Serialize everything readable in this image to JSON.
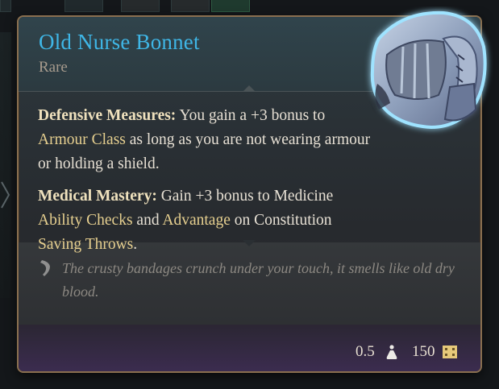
{
  "item": {
    "name": "Old Nurse Bonnet",
    "rarity": "Rare",
    "colors": {
      "name": "#3fb6e6",
      "rarity": "#a89c8e",
      "highlight": "#e6cf8f",
      "frame": "#8a6f4f"
    },
    "passives": [
      {
        "title": "Defensive Measures:",
        "text1": " You gain a +3 bonus to ",
        "link1": "Armour Class",
        "text2": " as long as you are not wearing armour or holding a shield."
      },
      {
        "title": "Medical Mastery:",
        "text1": " Gain +3 bonus to Medicine ",
        "link1": "Ability Checks",
        "text2": " and ",
        "link2": "Advantage",
        "text3": " on Constitution ",
        "link3": "Saving Throws",
        "text4": "."
      }
    ],
    "flavor": "The crusty bandages crunch under your touch, it smells like old dry blood.",
    "weight": "0.5",
    "price": "150",
    "icons": {
      "weight": "weight-icon",
      "price": "gold-icon",
      "flavor": "feather-icon",
      "portrait": "bonnet-item-image"
    }
  }
}
